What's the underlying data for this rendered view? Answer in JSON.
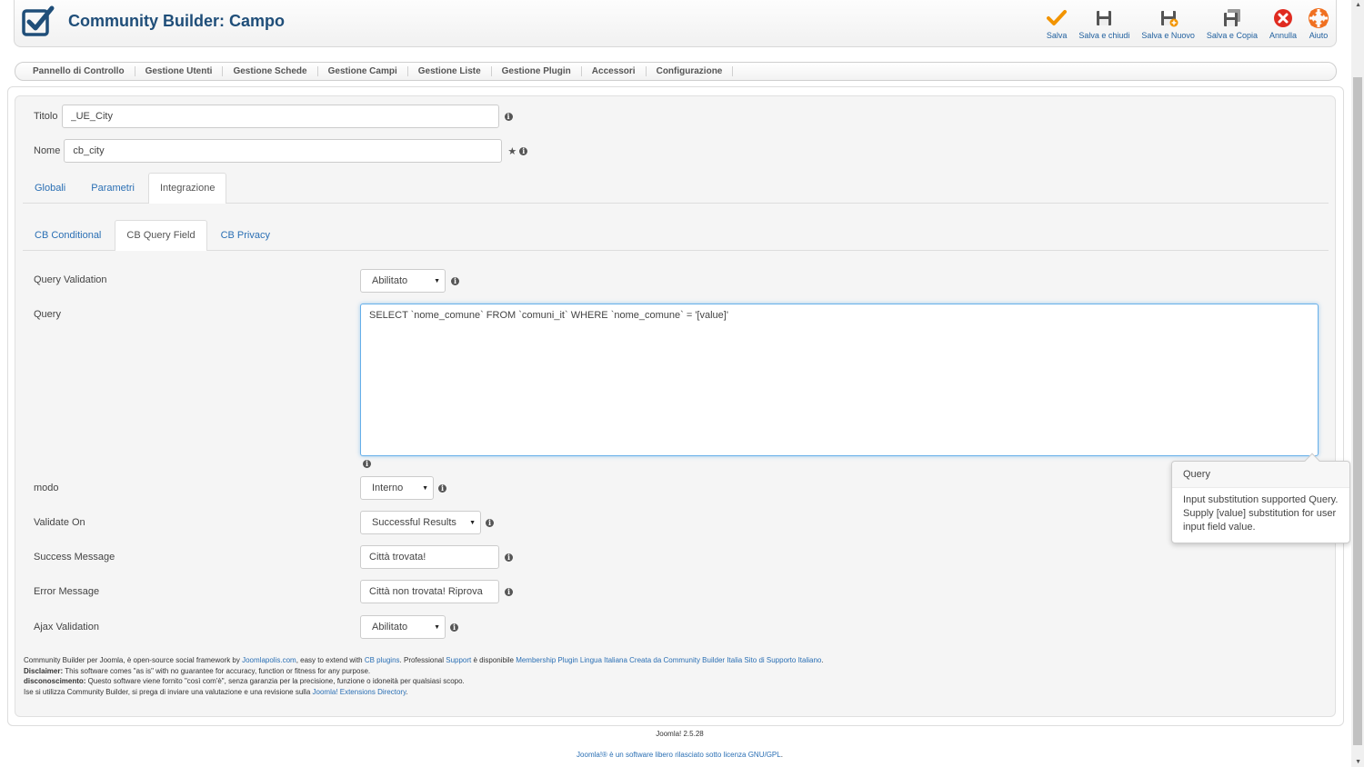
{
  "header": {
    "title": "Community Builder: Campo"
  },
  "toolbar": [
    {
      "label": "Salva",
      "icon": "checkmark-icon"
    },
    {
      "label": "Salva e chiudi",
      "icon": "floppy-icon"
    },
    {
      "label": "Salva e Nuovo",
      "icon": "floppy-plus-icon"
    },
    {
      "label": "Salva e Copia",
      "icon": "floppy-copy-icon"
    },
    {
      "label": "Annulla",
      "icon": "cancel-icon"
    },
    {
      "label": "Aiuto",
      "icon": "help-icon"
    }
  ],
  "nav": [
    "Pannello di Controllo",
    "Gestione Utenti",
    "Gestione Schede",
    "Gestione Campi",
    "Gestione Liste",
    "Gestione Plugin",
    "Accessori",
    "Configurazione"
  ],
  "form": {
    "titolo_label": "Titolo",
    "titolo_value": "_UE_City",
    "nome_label": "Nome",
    "nome_value": "cb_city"
  },
  "tabs": [
    "Globali",
    "Parametri",
    "Integrazione"
  ],
  "subtabs": [
    "CB Conditional",
    "CB Query Field",
    "CB Privacy"
  ],
  "fields": {
    "query_validation": {
      "label": "Query Validation",
      "value": "Abilitato"
    },
    "query": {
      "label": "Query",
      "value": "SELECT `nome_comune` FROM `comuni_it` WHERE `nome_comune` = '[value]'"
    },
    "modo": {
      "label": "modo",
      "value": "Interno"
    },
    "validate_on": {
      "label": "Validate On",
      "value": "Successful Results"
    },
    "success_message": {
      "label": "Success Message",
      "value": "Città trovata!"
    },
    "error_message": {
      "label": "Error Message",
      "value": "Città non trovata! Riprova"
    },
    "ajax_validation": {
      "label": "Ajax Validation",
      "value": "Abilitato"
    }
  },
  "tooltip": {
    "title": "Query",
    "body": "Input substitution supported Query. Supply [value] substitution for user input field value."
  },
  "footer": {
    "l1_a": "Community Builder per Joomla, è open-source social framework by ",
    "l1_link1": "Joomlapolis.com",
    "l1_b": ", easy to extend with ",
    "l1_link2": "CB plugins",
    "l1_c": ". Professional ",
    "l1_link3": "Support",
    "l1_d": " è disponibile ",
    "l1_link4": "Membership Plugin Lingua Italiana Creata da Community Builder Italia Sito di Supporto Italiano",
    "l1_e": ".",
    "l2_bold": "Disclaimer:",
    "l2_text": " This software comes \"as is\" with no guarantee for accuracy, function or fitness for any purpose.",
    "l3_bold": "disconoscimento:",
    "l3_text": " Questo software viene fornito \"così com'è\", senza garanzia per la precisione, funzione o idoneità per qualsiasi scopo.",
    "l4_text": "Ise si utilizza Community Builder, si prega di inviare una valutazione e una revisione sulla ",
    "l4_link": "Joomla! Extensions Directory",
    "l4_end": "."
  },
  "page_footer": {
    "version": "Joomla! 2.5.28",
    "license_a": "Joomla!® è un software libero rilasciato sotto ",
    "license_link": "licenza GNU/GPL",
    "license_end": "."
  },
  "colors": {
    "brand": "#1f4e79",
    "link": "#2a6fb4",
    "save": "#f29400",
    "cancel": "#e02b20"
  }
}
